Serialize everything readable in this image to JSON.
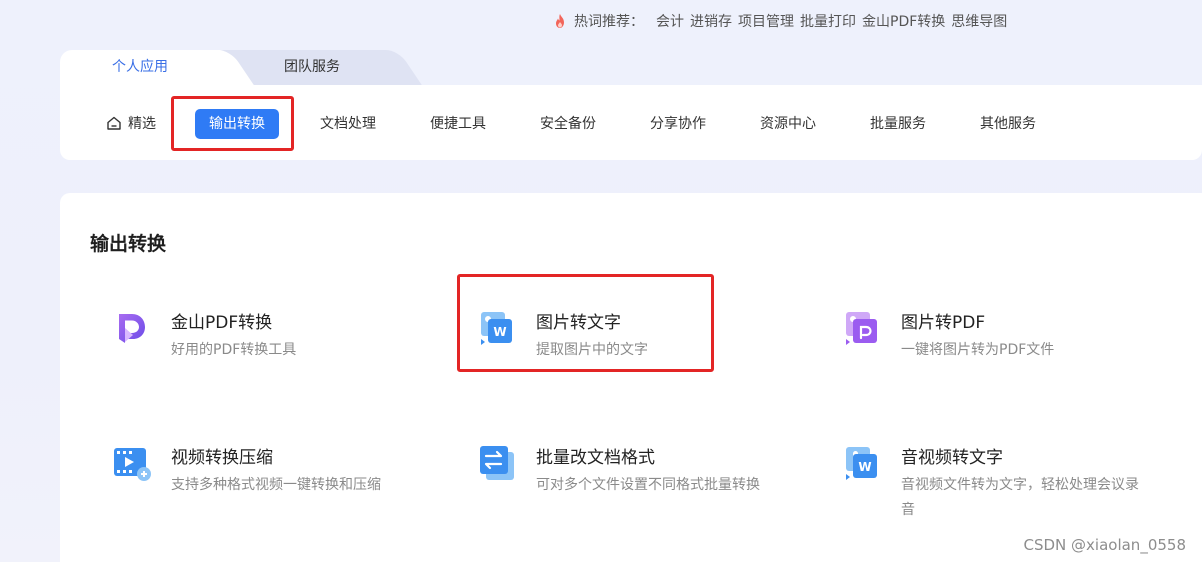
{
  "hotwords": {
    "label": "热词推荐：",
    "links": [
      "会计",
      "进销存",
      "项目管理",
      "批量打印",
      "金山PDF转换",
      "思维导图"
    ]
  },
  "tabs": {
    "personal": "个人应用",
    "team": "团队服务"
  },
  "nav": {
    "featured": "精选",
    "output_convert": "输出转换",
    "doc_processing": "文档处理",
    "handy_tools": "便捷工具",
    "security_backup": "安全备份",
    "share_collab": "分享协作",
    "resource_center": "资源中心",
    "batch_service": "批量服务",
    "other_service": "其他服务"
  },
  "section": {
    "title": "输出转换"
  },
  "cards": [
    {
      "title": "金山PDF转换",
      "desc": "好用的PDF转换工具"
    },
    {
      "title": "图片转文字",
      "desc": "提取图片中的文字"
    },
    {
      "title": "图片转PDF",
      "desc": "一键将图片转为PDF文件"
    },
    {
      "title": "视频转换压缩",
      "desc": "支持多种格式视频一键转换和压缩"
    },
    {
      "title": "批量改文档格式",
      "desc": "可对多个文件设置不同格式批量转换"
    },
    {
      "title": "音视频转文字",
      "desc": "音视频文件转为文字，轻松处理会议录音"
    }
  ],
  "watermark": "CSDN @xiaolan_0558",
  "colors": {
    "accent": "#2f7bf5",
    "highlight": "#e32525"
  }
}
